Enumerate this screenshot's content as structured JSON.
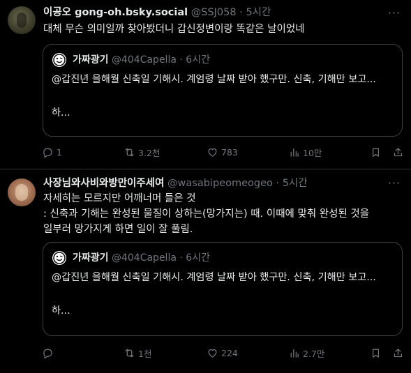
{
  "tweets": [
    {
      "name": "이공오 gong-oh.bsky.social",
      "handle": "@SSJ058",
      "dot": "·",
      "time": "5시간",
      "text": "대체 무슨 의미일까 찾아봤더니 갑신정변이랑 똑같은 날이었네",
      "quote": {
        "name": "가짜광기",
        "handle": "@404Capella",
        "dot": "·",
        "time": "6시간",
        "text": "@갑진년 을해월 신축일 기해시. 계엄령 날짜 받아 했구만. 신축, 기해만 보고...\n\n하..."
      },
      "actions": {
        "reply": "1",
        "repost": "3.2천",
        "like": "783",
        "views": "10만"
      }
    },
    {
      "name": "사장님와사비와방만이주세여",
      "handle": "@wasabipeomeogeo",
      "dot": "·",
      "time": "5시간",
      "text": "자세히는 모르지만 어깨너머 들은 것\n: 신축과 기해는 완성된 물질이 상하는(망가지는) 때. 이때에 맞춰 완성된 것을\n일부러 망가지게 하면 일이 잘 풀림.",
      "quote": {
        "name": "가짜광기",
        "handle": "@404Capella",
        "dot": "·",
        "time": "6시간",
        "text": "@갑진년 을해월 신축일 기해시. 계엄령 날짜 받아 했구만. 신축, 기해만 보고...\n\n하..."
      },
      "actions": {
        "reply": "",
        "repost": "1천",
        "like": "224",
        "views": "2.7만"
      }
    }
  ],
  "icons": {
    "more": "more-icon",
    "reply": "reply-icon",
    "repost": "repost-icon",
    "like": "like-icon",
    "views": "views-icon",
    "bookmark": "bookmark-icon",
    "share": "share-icon"
  },
  "colors": {
    "background": "#000000",
    "text": "#e7e9ea",
    "secondary": "#71767b",
    "border": "#2f3336"
  }
}
